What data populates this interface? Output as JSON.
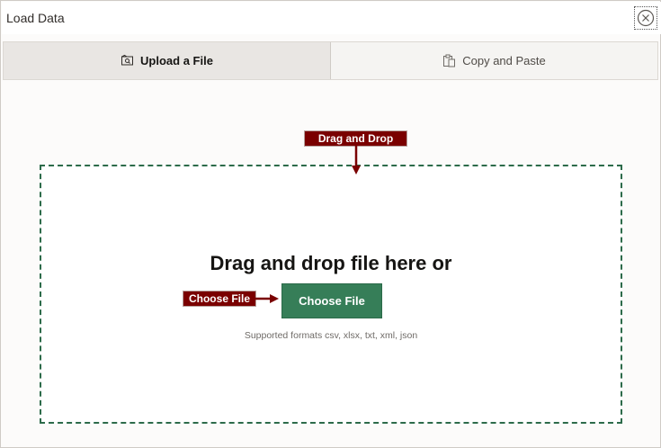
{
  "dialog": {
    "title": "Load Data"
  },
  "tabs": [
    {
      "label": "Upload a File",
      "active": true
    },
    {
      "label": "Copy and Paste",
      "active": false
    }
  ],
  "dropzone": {
    "heading": "Drag and drop file here or",
    "button_label": "Choose File",
    "formats_text": "Supported formats csv, xlsx, txt, xml, json"
  },
  "callouts": {
    "drag_drop": "Drag and Drop",
    "choose_file": "Choose File"
  },
  "colors": {
    "accent_green": "#367e58",
    "dash_border": "#2d6b4a",
    "callout_red": "#7a0000"
  },
  "icons": {
    "close": "close-icon",
    "upload": "upload-file-icon",
    "paste": "paste-clipboard-icon"
  }
}
